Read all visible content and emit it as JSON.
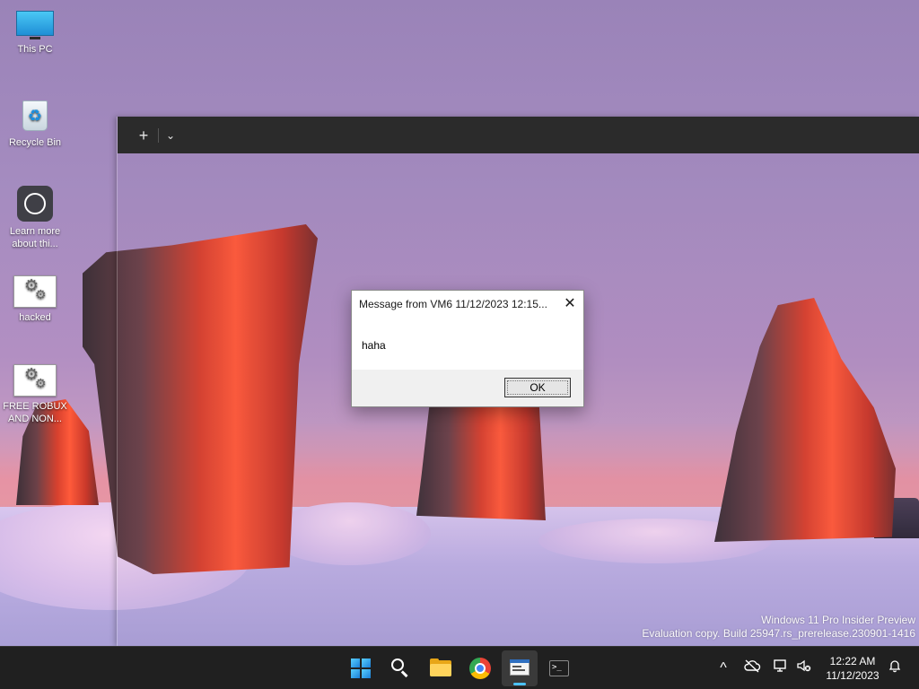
{
  "desktop_icons": [
    {
      "label": "This PC",
      "icon": "monitor-icon"
    },
    {
      "label": "Recycle Bin",
      "icon": "recycle-bin-icon"
    },
    {
      "label_line1": "Learn more",
      "label_line2": "about thi...",
      "icon": "learn-more-icon"
    },
    {
      "label": "hacked",
      "icon": "config-file-icon"
    },
    {
      "label_line1": "FREE ROBUX",
      "label_line2": "AND NON...",
      "icon": "config-file-icon"
    }
  ],
  "terminal": {
    "new_tab_glyph": "+",
    "dropdown_glyph": "⌄"
  },
  "dialog": {
    "title": "Message from VM6 11/12/2023 12:15...",
    "close_glyph": "✕",
    "message": "haha",
    "ok_label": "OK"
  },
  "watermark": {
    "line1": "Windows 11 Pro Insider Preview",
    "line2": "Evaluation copy. Build 25947.rs_prerelease.230901-1416"
  },
  "taskbar": {
    "apps": [
      {
        "name": "start",
        "icon": "windows-start-icon"
      },
      {
        "name": "search",
        "icon": "search-icon"
      },
      {
        "name": "file-explorer",
        "icon": "folder-icon"
      },
      {
        "name": "chrome",
        "icon": "chrome-icon"
      },
      {
        "name": "message-app",
        "icon": "window-app-icon",
        "active": true
      },
      {
        "name": "terminal",
        "icon": "terminal-icon"
      }
    ],
    "tray": {
      "chevron_glyph": "^",
      "clock_time": "12:22 AM",
      "clock_date": "11/12/2023"
    }
  },
  "colors": {
    "taskbar_bg": "#202020",
    "accent": "#4cc2ff",
    "dialog_bg": "#f0f0f0"
  }
}
